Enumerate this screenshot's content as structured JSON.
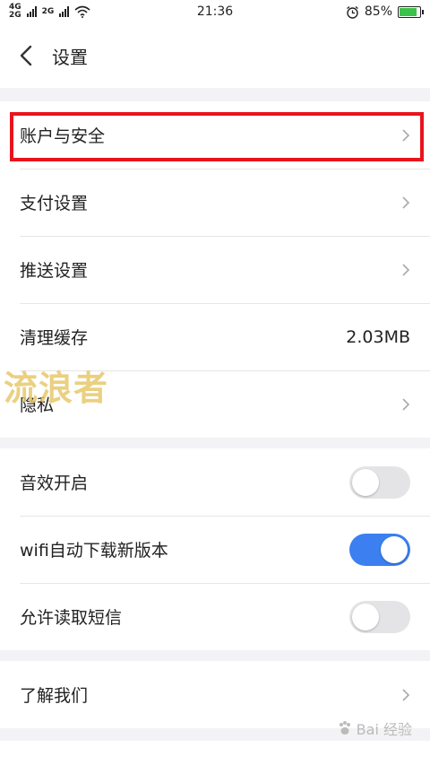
{
  "status_bar": {
    "network_top": "4G",
    "network_bottom": "2G",
    "network_top2": "2G",
    "time": "21:36",
    "battery": "85%"
  },
  "header": {
    "title": "设置"
  },
  "groups": [
    {
      "items": [
        {
          "label": "账户与安全"
        },
        {
          "label": "支付设置"
        },
        {
          "label": "推送设置"
        },
        {
          "label": "清理缓存",
          "value": "2.03MB"
        },
        {
          "label": "隐私"
        }
      ]
    },
    {
      "items": [
        {
          "label": "音效开启",
          "toggle": false
        },
        {
          "label": "wifi自动下载新版本",
          "toggle": true
        },
        {
          "label": "允许读取短信",
          "toggle": false
        }
      ]
    },
    {
      "items": [
        {
          "label": "了解我们"
        }
      ]
    }
  ],
  "watermark": "流浪者",
  "baidu_watermark": "Bai 经验",
  "colors": {
    "highlight": "#e8141d",
    "toggle_on": "#3b7ff0",
    "battery": "#3bc24a"
  }
}
